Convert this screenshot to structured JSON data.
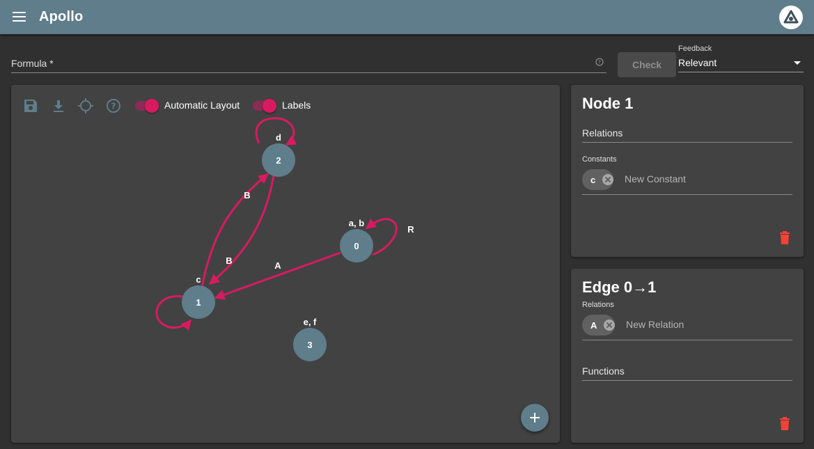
{
  "app": {
    "title": "Apollo",
    "accent": "#d81b60",
    "primary": "#5f7d8b"
  },
  "formula": {
    "label": "Formula *",
    "value": ""
  },
  "check_button": {
    "label": "Check"
  },
  "feedback": {
    "label": "Feedback",
    "selected": "Relevant"
  },
  "toolbar": {
    "icons": [
      "save-icon",
      "download-icon",
      "crosshair-icon",
      "help-icon"
    ],
    "automatic_layout": {
      "label": "Automatic Layout",
      "on": true
    },
    "labels": {
      "label": "Labels",
      "on": true
    }
  },
  "graph": {
    "nodes": [
      {
        "id": "0",
        "label": "a, b"
      },
      {
        "id": "1",
        "label": "c"
      },
      {
        "id": "2",
        "label": "d"
      },
      {
        "id": "3",
        "label": "e, f"
      }
    ],
    "edges": [
      {
        "from": "2",
        "to": "2",
        "label": ""
      },
      {
        "from": "1",
        "to": "2",
        "label": "B"
      },
      {
        "from": "2",
        "to": "1",
        "label": "B"
      },
      {
        "from": "0",
        "to": "0",
        "label": "R"
      },
      {
        "from": "0",
        "to": "1",
        "label": "A"
      },
      {
        "from": "1",
        "to": "1",
        "label": ""
      }
    ]
  },
  "node_card": {
    "title": "Node 1",
    "relations_label": "Relations",
    "constants_label": "Constants",
    "constants": [
      "c"
    ],
    "new_constant_placeholder": "New Constant"
  },
  "edge_card": {
    "title": "Edge 0→1",
    "relations_label": "Relations",
    "relations": [
      "A"
    ],
    "new_relation_placeholder": "New Relation",
    "functions_label": "Functions"
  }
}
